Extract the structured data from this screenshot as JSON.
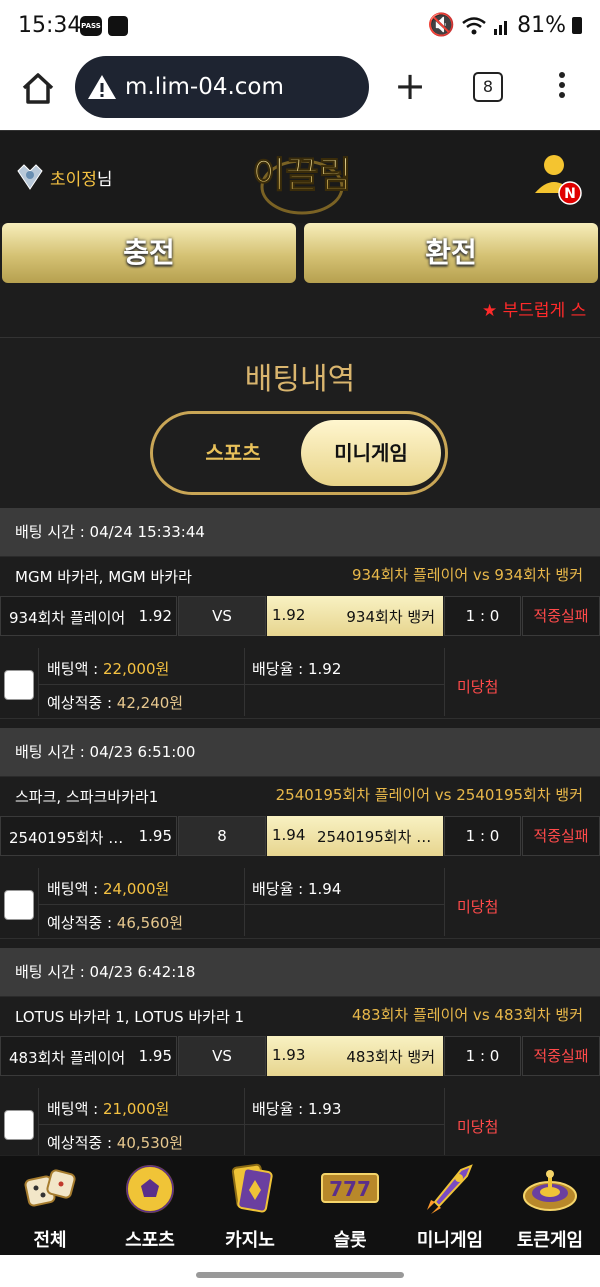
{
  "status_bar": {
    "time": "15:34",
    "pass_label": "PASS",
    "battery": "81%"
  },
  "browser": {
    "url": "m.lim-04.com",
    "tab_count": "8"
  },
  "header": {
    "username": "초이정",
    "username_suffix": "님",
    "logo_text": "이끌림",
    "notification_badge": "N"
  },
  "actions": {
    "deposit_label": "충전",
    "withdraw_label": "환전"
  },
  "marquee": "★ 부드럽게 스",
  "page": {
    "title": "배팅내역",
    "tabs": [
      {
        "label": "스포츠",
        "active": false
      },
      {
        "label": "미니게임",
        "active": true
      }
    ]
  },
  "labels": {
    "bet_amount": "배팅액 : ",
    "odds": "배당율 : ",
    "expected_win": "예상적중 : "
  },
  "bets": [
    {
      "time": "배팅 시간 : 04/24 15:33:44",
      "game": "MGM 바카라, MGM 바카라",
      "matchup": "934회차 플레이어  vs  934회차 뱅커",
      "left_name": "934회차 플레이어",
      "left_odds": "1.92",
      "middle": "VS",
      "right_odds": "1.92",
      "right_name": "934회차 뱅커",
      "score": "1 : 0",
      "result": "적중실패",
      "bet_amount": "22,000원",
      "odds": "1.92",
      "expected_win": "42,240원",
      "status": "미당첨"
    },
    {
      "time": "배팅 시간 : 04/23 6:51:00",
      "game": "스파크, 스파크바카라1",
      "matchup": "2540195회차 플레이어  vs  2540195회차 뱅커",
      "left_name": "2540195회차 플레이어",
      "left_odds": "1.95",
      "middle": "8",
      "right_odds": "1.94",
      "right_name": "2540195회차 뱅커",
      "score": "1 : 0",
      "result": "적중실패",
      "bet_amount": "24,000원",
      "odds": "1.94",
      "expected_win": "46,560원",
      "status": "미당첨"
    },
    {
      "time": "배팅 시간 : 04/23 6:42:18",
      "game": "LOTUS 바카라 1, LOTUS 바카라 1",
      "matchup": "483회차 플레이어  vs  483회차 뱅커",
      "left_name": "483회차 플레이어",
      "left_odds": "1.95",
      "middle": "VS",
      "right_odds": "1.93",
      "right_name": "483회차 뱅커",
      "score": "1 : 0",
      "result": "적중실패",
      "bet_amount": "21,000원",
      "odds": "1.93",
      "expected_win": "40,530원",
      "status": "미당첨"
    }
  ],
  "bottom_nav": [
    {
      "label": "전체",
      "icon": "dice-icon"
    },
    {
      "label": "스포츠",
      "icon": "soccer-ball-icon"
    },
    {
      "label": "카지노",
      "icon": "cards-icon"
    },
    {
      "label": "슬롯",
      "icon": "slot-777-icon"
    },
    {
      "label": "미니게임",
      "icon": "rocket-icon"
    },
    {
      "label": "토큰게임",
      "icon": "roulette-icon"
    }
  ],
  "slot_text": "777",
  "colors": {
    "gold": "#d9b56e",
    "accent_red": "#ff4a4a",
    "highlight": "#f5c242"
  }
}
